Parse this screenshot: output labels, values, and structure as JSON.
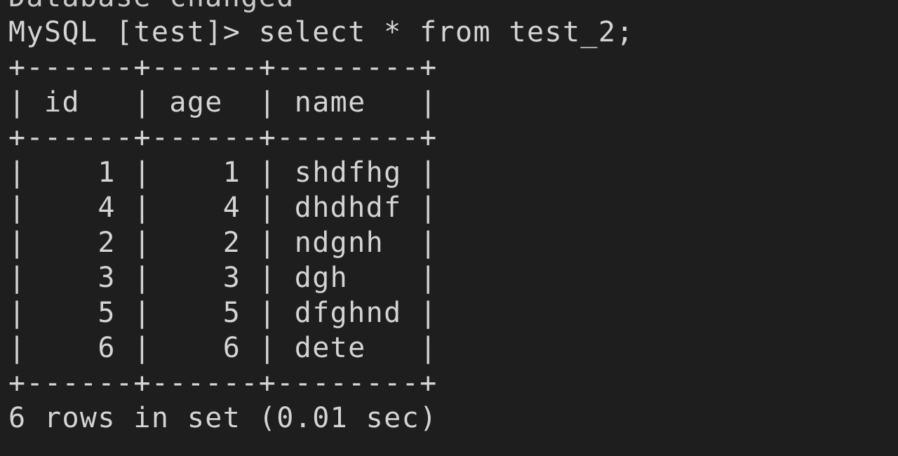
{
  "terminal": {
    "background": "#1e1e1e",
    "foreground": "#d4d4d4",
    "previous_output": "Database changed",
    "prompt": "MySQL [test]> ",
    "command": "select * from test_2;",
    "border_line": "+------+------+--------+",
    "header_line": "| id   | age  | name   |",
    "table": {
      "columns": [
        "id",
        "age",
        "name"
      ],
      "rows": [
        {
          "id": 1,
          "age": 1,
          "name": "shdfhg",
          "text": "|    1 |    1 | shdfhg |"
        },
        {
          "id": 4,
          "age": 4,
          "name": "dhdhdf",
          "text": "|    4 |    4 | dhdhdf |"
        },
        {
          "id": 2,
          "age": 2,
          "name": "ndgnh",
          "text": "|    2 |    2 | ndgnh  |"
        },
        {
          "id": 3,
          "age": 3,
          "name": "dgh",
          "text": "|    3 |    3 | dgh    |"
        },
        {
          "id": 5,
          "age": 5,
          "name": "dfghnd",
          "text": "|    5 |    5 | dfghnd |"
        },
        {
          "id": 6,
          "age": 6,
          "name": "dete",
          "text": "|    6 |    6 | dete   |"
        }
      ]
    },
    "result_summary": "6 rows in set (0.01 sec)"
  }
}
